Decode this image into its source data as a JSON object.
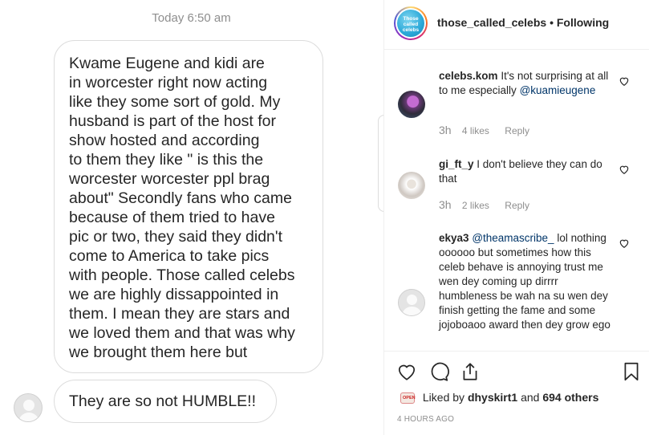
{
  "chat": {
    "timestamp": "Today 6:50 am",
    "message_main": "Kwame Eugene and kidi are\nin worcester right now acting\nlike they some sort of gold. My\nhusband is part of the host for\nshow hosted and according\nto them they like \" is this the\nworcester worcester ppl brag\nabout\" Secondly fans who came\nbecause of them tried to have\npic or two, they said they didn't\ncome to America to take pics\nwith people. Those called celebs\nwe are highly dissappointed in\nthem. I mean they are stars and\nwe loved them and that was why\nwe brought them here but",
    "message_small": "They are  so not HUMBLE!!"
  },
  "post": {
    "username": "those_called_celebs",
    "separator": "•",
    "follow_status": "Following",
    "profile_image_text": "Those called celebs",
    "comments": [
      {
        "user": "celebs.kom",
        "text": "It's not surprising at all to me especially",
        "mention": "@kuamieugene",
        "age": "3h",
        "likes": "4 likes",
        "reply": "Reply",
        "avatar": "purple-photo"
      },
      {
        "user": "gi_ft_y",
        "text": "I don't believe they can do that",
        "mention": "",
        "age": "3h",
        "likes": "2 likes",
        "reply": "Reply",
        "avatar": "woman-photo"
      },
      {
        "user": "ekya3",
        "mention": "@theamascribe_",
        "text": "lol nothing oooooo but sometimes how this celeb behave is annoying trust me wen dey coming up dirrrr humbleness be wah na su wen dey finish getting the fame and some jojoboaoo award then dey grow ego",
        "avatar": "default"
      }
    ],
    "liked_by_prefix": "Liked by",
    "liked_by_user": "dhyskirt1",
    "liked_by_and": "and",
    "liked_by_count": "694 others",
    "liked_thumb_text": "OPEN",
    "post_age": "4 HOURS AGO"
  },
  "colors": {
    "text": "#262626",
    "muted": "#8e8e8e",
    "mention": "#003569",
    "border": "#efefef"
  }
}
